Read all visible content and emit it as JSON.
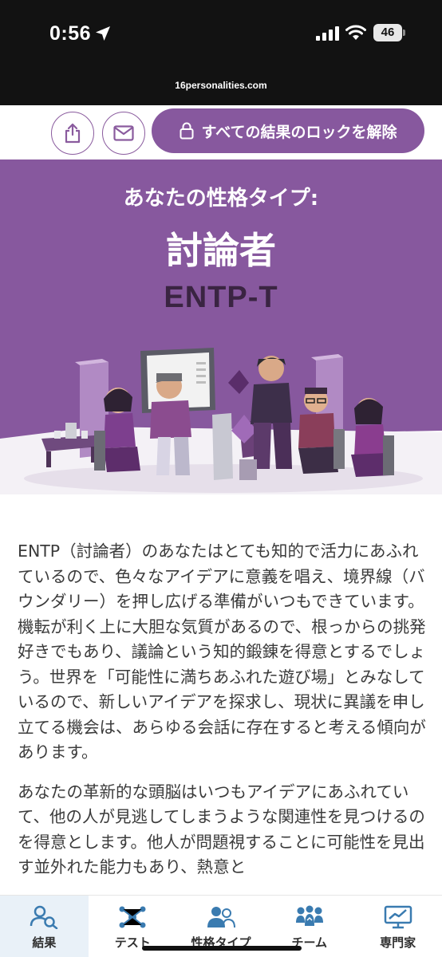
{
  "status_bar": {
    "time": "0:56",
    "battery": "46",
    "url": "16personalities.com"
  },
  "actions": {
    "share_icon": "share-icon",
    "email_icon": "mail-icon",
    "unlock_label": "すべての結果のロックを解除"
  },
  "hero": {
    "subtitle": "あなたの性格タイプ:",
    "title": "討論者",
    "code": "ENTP-T",
    "background_color": "#87589e"
  },
  "content": {
    "paragraphs": [
      "ENTP（討論者）のあなたはとても知的で活力にあふれているので、色々なアイデアに意義を唱え、境界線（バウンダリー）を押し広げる準備がいつもできています。機転が利く上に大胆な気質があるので、根っからの挑発好きでもあり、議論という知的鍛錬を得意とするでしょう。世界を「可能性に満ちあふれた遊び場」とみなしているので、新しいアイデアを探求し、現状に異議を申し立てる機会は、あらゆる会話に存在すると考える傾向があります。",
      "あなたの革新的な頭脳はいつもアイデアにあふれていて、他の人が見逃してしまうような関連性を見つけるのを得意とします。他人が問題視することに可能性を見出す並外れた能力もあり、熱意と"
    ]
  },
  "bottom_nav": {
    "items": [
      {
        "label": "結果",
        "icon": "results-icon",
        "active": true
      },
      {
        "label": "テスト",
        "icon": "test-icon",
        "active": false
      },
      {
        "label": "性格タイプ",
        "icon": "types-icon",
        "active": false
      },
      {
        "label": "チーム",
        "icon": "team-icon",
        "active": false
      },
      {
        "label": "専門家",
        "icon": "expert-icon",
        "active": false
      }
    ],
    "accent_color": "#3a7bb0"
  }
}
